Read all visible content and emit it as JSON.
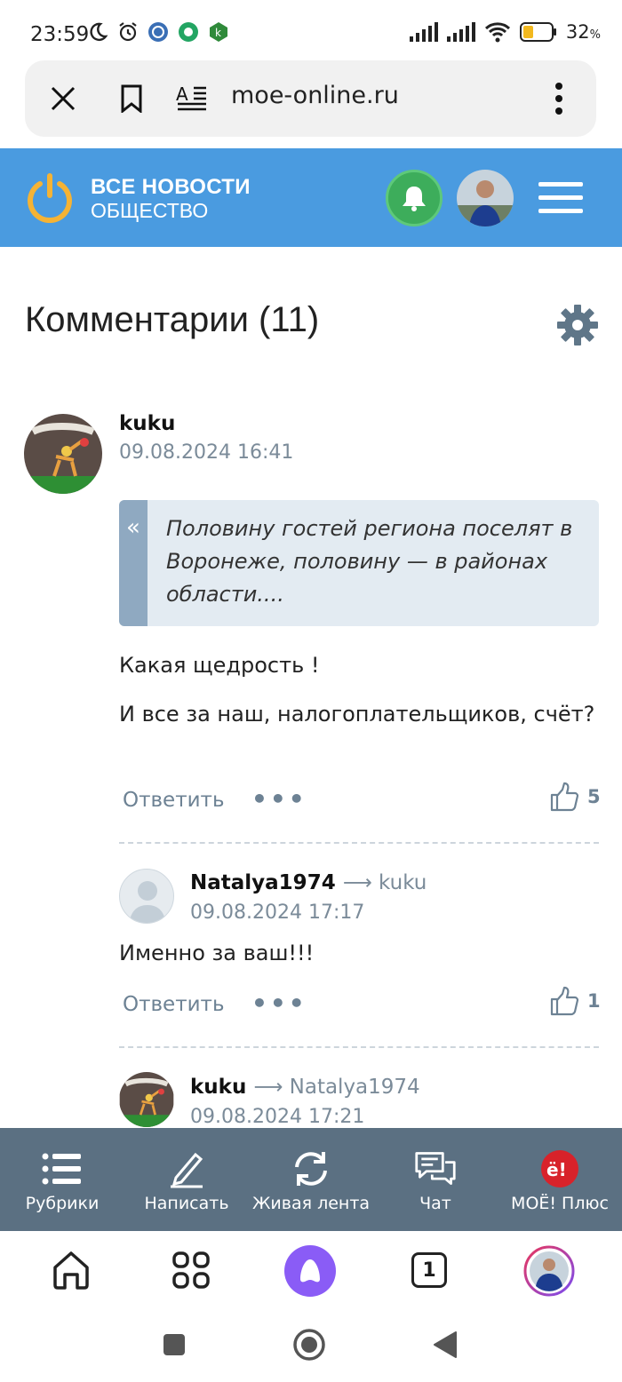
{
  "status": {
    "time": "23:59",
    "battery": "32",
    "battery_unit": "%"
  },
  "browser": {
    "url": "moe-online.ru"
  },
  "site": {
    "title_top": "ВСЕ НОВОСТИ",
    "title_bottom": "ОБЩЕСТВО",
    "accent_color": "#4a9be0"
  },
  "comments": {
    "heading": "Комментарии (11)",
    "items": [
      {
        "author": "kuku",
        "date": "09.08.2024 16:41",
        "quote": "Половину гостей региона поселят в Воронеже, половину — в районах области....",
        "paragraphs": [
          "Какая щедрость !",
          "И все за наш, налогоплательщиков, счёт?"
        ],
        "reply_label": "Ответить",
        "more": "•••",
        "likes": "5"
      },
      {
        "author": "Natalya1974",
        "reply_to": "⟶ kuku",
        "date": "09.08.2024 17:17",
        "text": "Именно за ваш!!!",
        "reply_label": "Ответить",
        "more": "•••",
        "likes": "1"
      },
      {
        "author": "kuku",
        "reply_to": "⟶ Natalya1974",
        "date": "09.08.2024 17:21"
      }
    ]
  },
  "site_nav": {
    "items": [
      {
        "label": "Рубрики",
        "icon": "list-icon"
      },
      {
        "label": "Написать",
        "icon": "pencil-icon"
      },
      {
        "label": "Живая лента",
        "icon": "refresh-icon"
      },
      {
        "label": "Чат",
        "icon": "chat-icon"
      },
      {
        "label": "МОЁ! Плюс",
        "icon": "moe-plus-icon"
      }
    ]
  },
  "browser_nav": {
    "tab_count": "1"
  }
}
